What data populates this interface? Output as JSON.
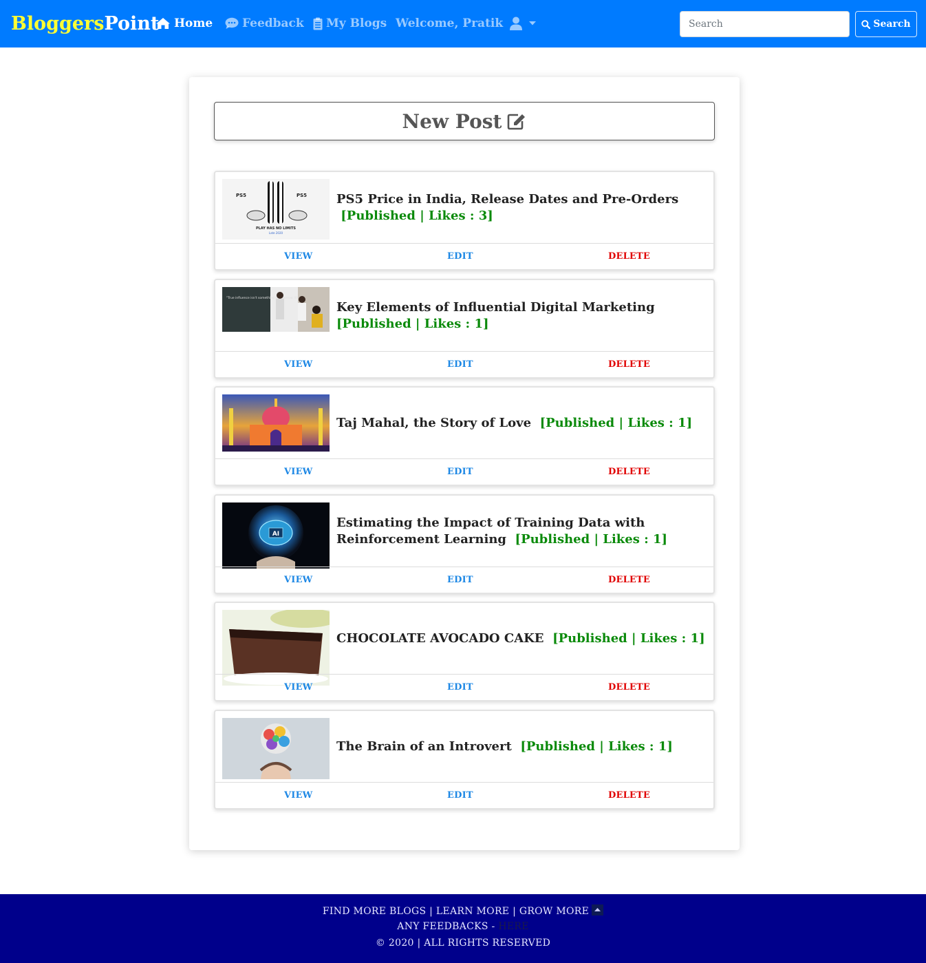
{
  "brand": {
    "part1": "Bloggers",
    "part2": "Point"
  },
  "nav": {
    "home": "Home",
    "feedback": "Feedback",
    "my_blogs": "My Blogs",
    "welcome": "Welcome, Pratik"
  },
  "search": {
    "placeholder": "Search",
    "button_label": "Search"
  },
  "new_post_label": "New Post",
  "actions": {
    "view": "VIEW",
    "edit": "EDIT",
    "delete": "DELETE"
  },
  "posts": [
    {
      "title": "PS5 Price in India, Release Dates and Pre-Orders",
      "status": "[Published | Likes : 3]",
      "thumb_caption": "PLAY HAS NO LIMITS",
      "thumb_sub": "Late 2020",
      "thumb_logo": "PS5"
    },
    {
      "title": "Key Elements of Influential Digital Marketing",
      "status": "[Published | Likes : 1]",
      "thumb_caption": "\"True influence isn't something you borrow. It's what you embody\""
    },
    {
      "title": "Taj Mahal, the Story of Love",
      "status": "[Published | Likes : 1]"
    },
    {
      "title": "Estimating the Impact of Training Data with Reinforcement Learning",
      "status": "[Published | Likes : 1]",
      "thumb_caption": "AI"
    },
    {
      "title": "CHOCOLATE AVOCADO CAKE",
      "status": "[Published | Likes : 1]"
    },
    {
      "title": "The Brain of an Introvert",
      "status": "[Published | Likes : 1]"
    }
  ],
  "footer": {
    "links": "FIND MORE BLOGS | LEARN MORE | GROW MORE",
    "feedback_prefix": "ANY FEEDBACKS -",
    "feedback_link": "HERE",
    "copyright": "© 2020 | ALL RIGHTS RESERVED"
  },
  "colors": {
    "navbar": "#007bff",
    "brand_accent": "#ffff33",
    "published": "#0a8a0a",
    "delete": "#e00000",
    "action": "#1e88e5",
    "footer": "#00008b"
  }
}
